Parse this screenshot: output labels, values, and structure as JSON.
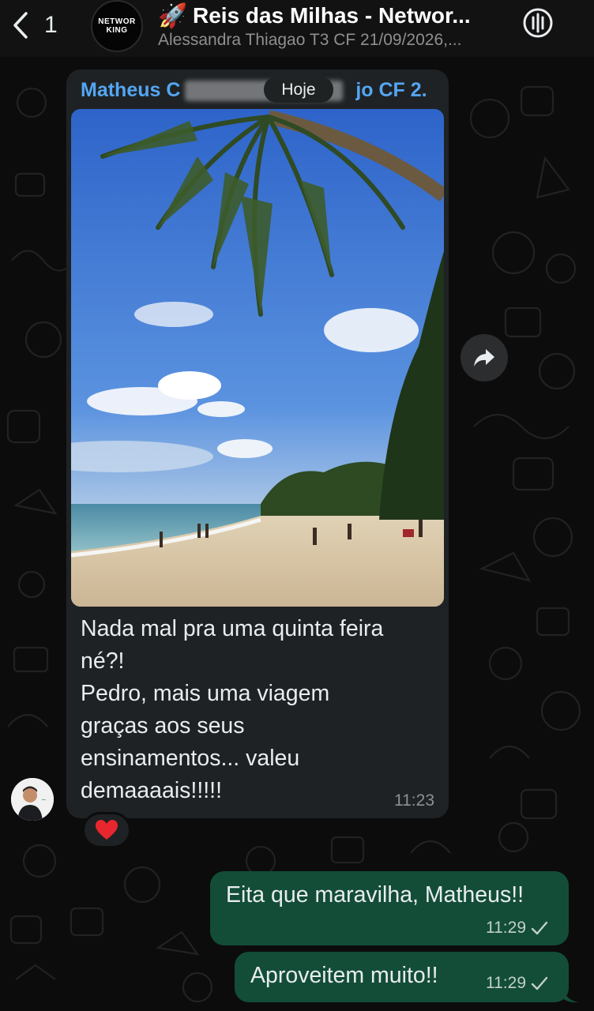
{
  "header": {
    "back_count": "1",
    "group_avatar_line1": "NETWOR",
    "group_avatar_line2": "KING",
    "group_emoji": "🚀",
    "group_title": "Reis das Milhas - Networ...",
    "group_subtitle": "Alessandra Thiagao T3 CF 21/09/2026,...",
    "call_icon": "voice-call-icon"
  },
  "date_separator": "Hoje",
  "incoming_message": {
    "sender": "Matheus C",
    "sender_tail": "jo CF 2...",
    "caption_lines": [
      "Nada mal pra uma quinta feira",
      "né?!",
      "Pedro, mais uma viagem",
      "graças aos seus",
      "ensinamentos... valeu",
      "demaaaais!!!!!"
    ],
    "time": "11:23",
    "reaction": "❤️",
    "image": "beach-palm-photo"
  },
  "outgoing_messages": [
    {
      "text": "Eita que maravilha, Matheus!!",
      "time": "11:29",
      "status": "sent"
    },
    {
      "text": "Aproveitem muito!!",
      "time": "11:29",
      "status": "sent"
    }
  ],
  "colors": {
    "incoming_bubble": "#1f2224",
    "outgoing_bubble": "#134d37",
    "sender_name": "#53a6f2",
    "background": "#0c0c0c"
  }
}
